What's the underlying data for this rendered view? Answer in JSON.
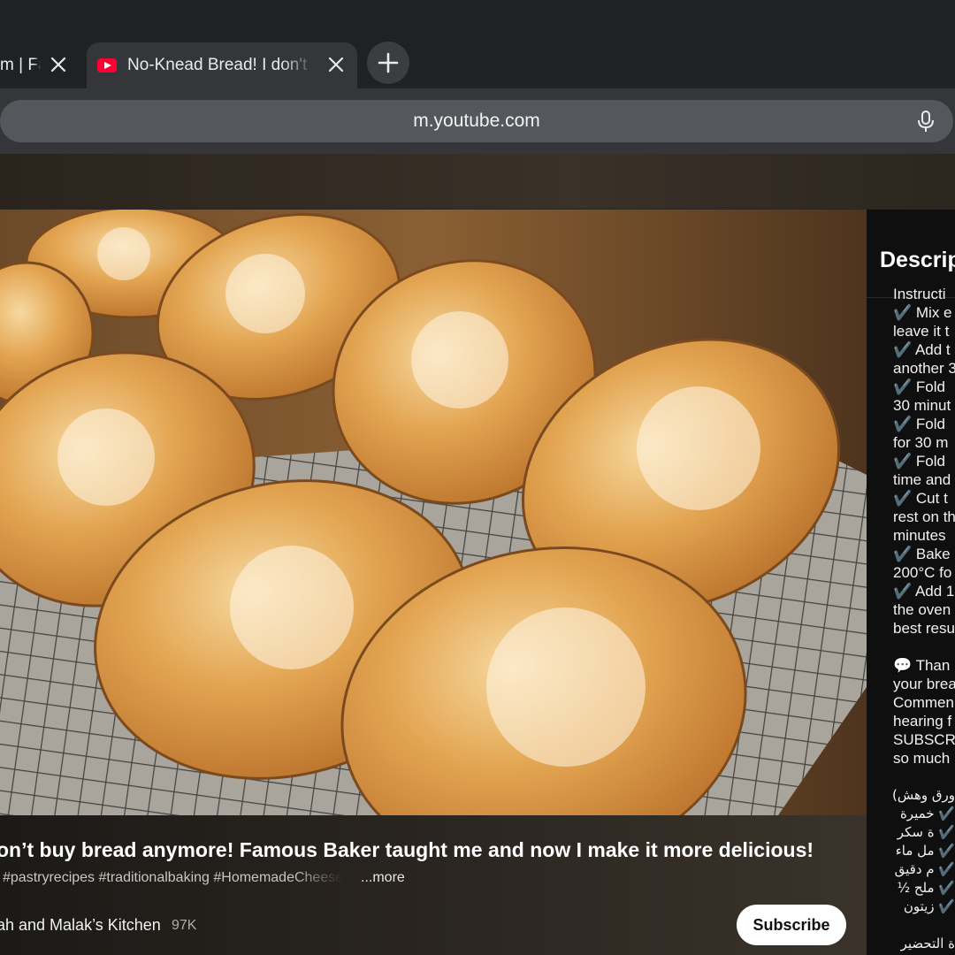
{
  "browser": {
    "tabs": [
      {
        "title": "m | Fa",
        "active": false
      },
      {
        "title": "No-Knead Bread! I don't",
        "active": true
      }
    ],
    "url": "m.youtube.com"
  },
  "video": {
    "title": "on’t buy bread anymore! Famous Baker taught me and now I make it more delicious!",
    "tags": "#pastryrecipes #traditionalbaking #HomemadeCheese",
    "more_label": "...more",
    "channel": "ah and Malak’s Kitchen",
    "subscribers": "97K",
    "subscribe_label": "Subscribe"
  },
  "description": {
    "heading": "Descrip",
    "lines": [
      "Instructi",
      "✔️ Mix e",
      "leave it t",
      "✔️ Add t",
      "another 3",
      "✔️ Fold",
      "30 minut",
      "✔️ Fold",
      "for 30 m",
      "✔️ Fold",
      "time and",
      "✔️ Cut t",
      "rest on th",
      "minutes",
      "✔️ Bake",
      "200°C fo",
      "✔️ Add 1",
      "the oven",
      "best resu",
      "",
      "💬 Than",
      "your brea",
      "Commen",
      "hearing f",
      "SUBSCR",
      "so much",
      "",
      "ورق وهش)",
      "✔️ خميرة",
      "✔️ ة سكر",
      "✔️ مل ماء",
      "✔️ م دقيق",
      "✔️ ملح ½",
      "✔️ زيتون",
      "",
      "ة التحضير"
    ]
  },
  "colors": {
    "browser_bg": "#202124",
    "active_tab": "#35363a",
    "omnibox": "#55575c",
    "youtube_red": "#ff0033",
    "subscribe_bg": "#ffffff"
  }
}
